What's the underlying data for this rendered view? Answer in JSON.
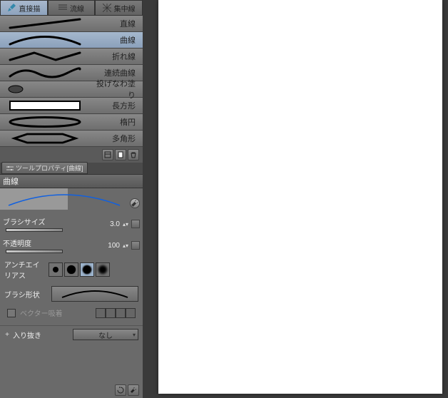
{
  "tabs": {
    "t1": "直接描",
    "t2": "流線",
    "t3": "集中線"
  },
  "tools": {
    "line": "直線",
    "curve": "曲線",
    "polyline": "折れ線",
    "continuous_curve": "連続曲線",
    "lasso_fill": "投げなわ塗り",
    "rectangle": "長方形",
    "ellipse": "楕円",
    "polygon": "多角形"
  },
  "prop_tab": "ツールプロパティ[曲線]",
  "title": "曲線",
  "props": {
    "brush_size_label": "ブラシサイズ",
    "brush_size_value": "3.0",
    "opacity_label": "不透明度",
    "opacity_value": "100",
    "aa_label": "アンチエイリアス",
    "brush_shape_label": "ブラシ形状",
    "vector_snap_label": "ベクター吸着",
    "inout_label": "入り抜き",
    "inout_value": "なし"
  }
}
